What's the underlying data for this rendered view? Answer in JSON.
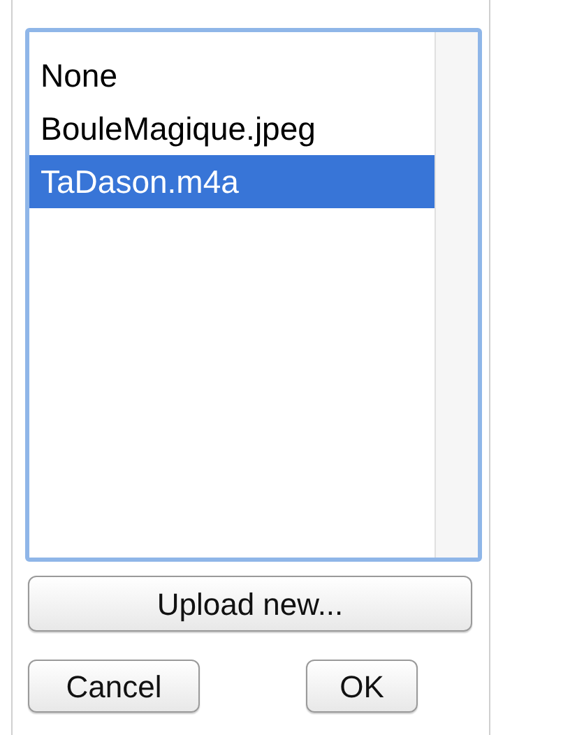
{
  "file_list": {
    "items": [
      {
        "label": "None",
        "selected": false
      },
      {
        "label": "BouleMagique.jpeg",
        "selected": false
      },
      {
        "label": "TaDason.m4a",
        "selected": true
      }
    ]
  },
  "buttons": {
    "upload": "Upload new...",
    "cancel": "Cancel",
    "ok": "OK"
  }
}
